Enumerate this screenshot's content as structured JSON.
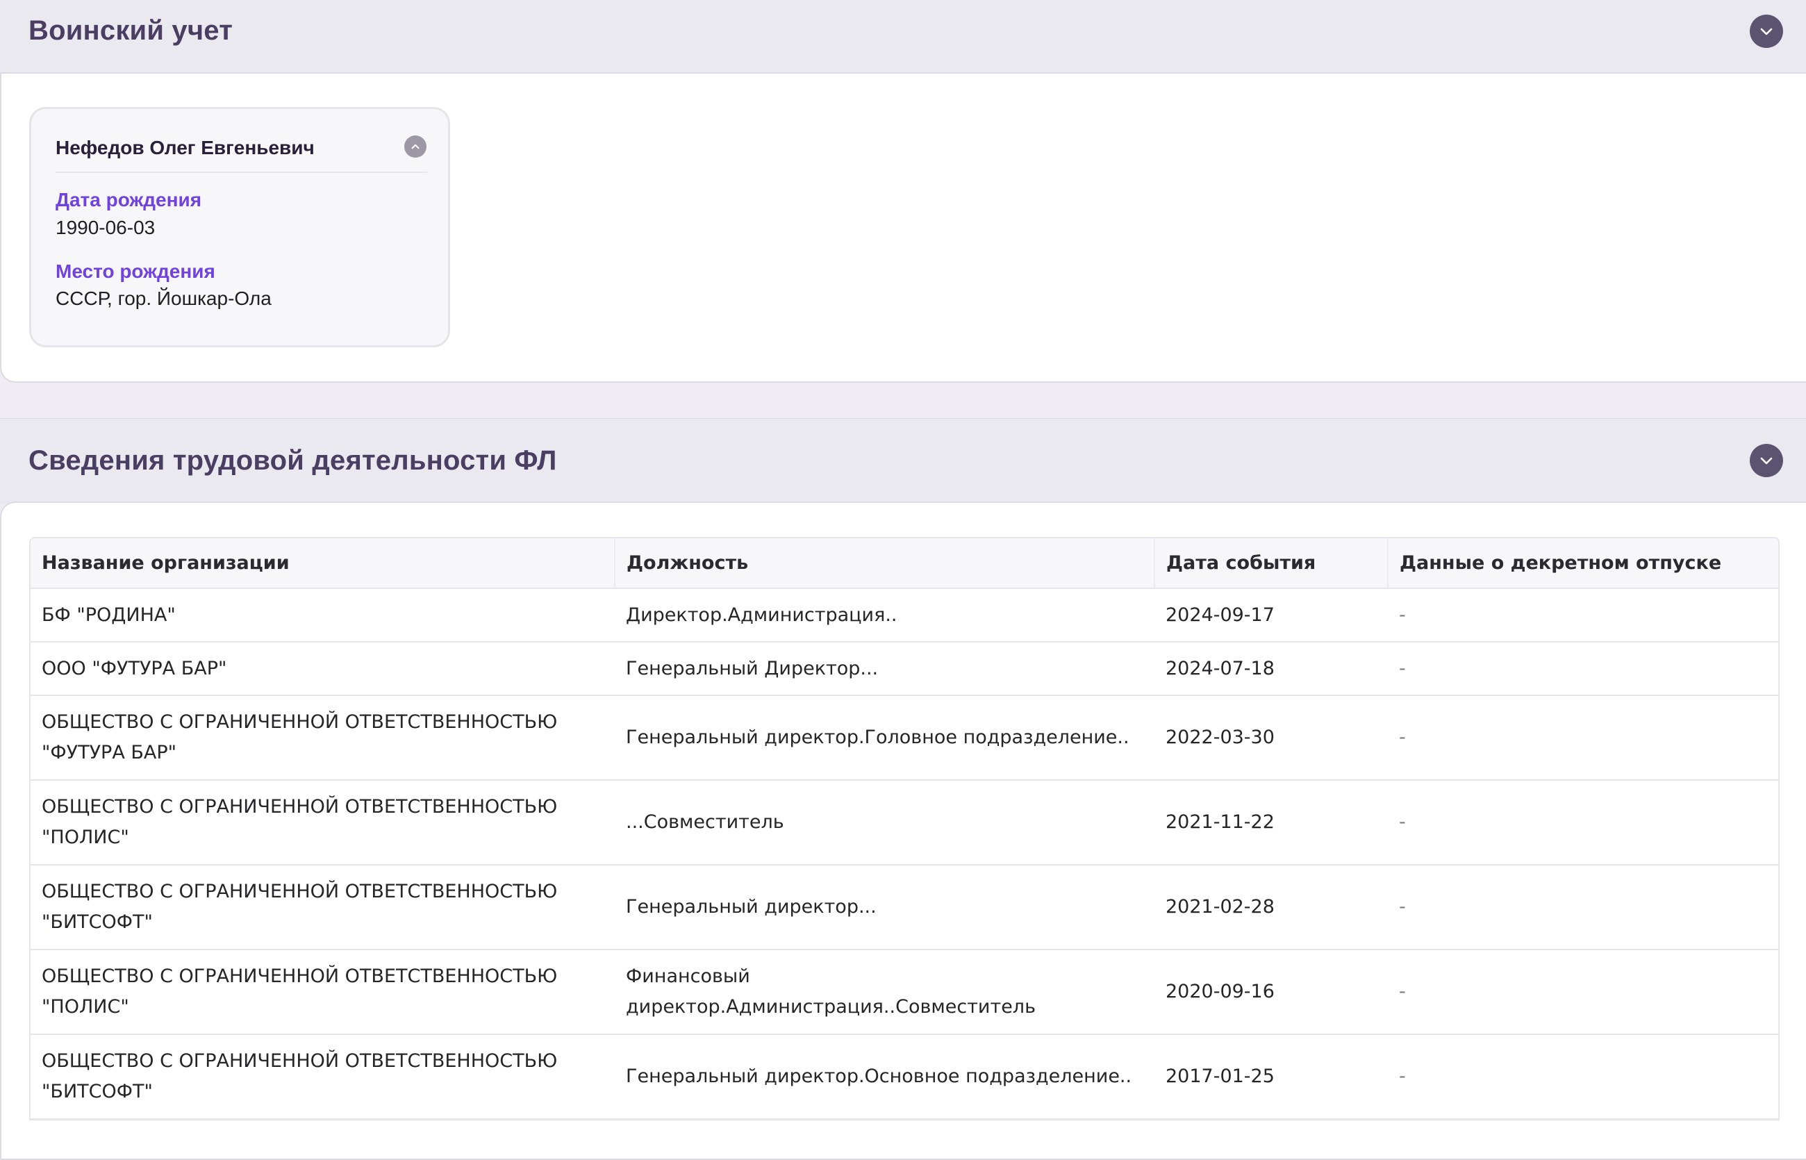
{
  "military": {
    "title": "Воинский учет",
    "person": {
      "name": "Нефедов Олег Евгеньевич",
      "birth_date_label": "Дата рождения",
      "birth_date": "1990-06-03",
      "birth_place_label": "Место рождения",
      "birth_place": "СССР, гор. Йошкар-Ола"
    }
  },
  "employment": {
    "title": "Сведения трудовой деятельности ФЛ",
    "columns": [
      "Название организации",
      "Должность",
      "Дата события",
      "Данные о декретном отпуске"
    ],
    "rows": [
      {
        "org": "БФ \"РОДИНА\"",
        "position": "Директор.Администрация..",
        "date": "2024-09-17",
        "maternity": "-"
      },
      {
        "org": "ООО \"ФУТУРА БАР\"",
        "position": "Генеральный Директор...",
        "date": "2024-07-18",
        "maternity": "-"
      },
      {
        "org": "ОБЩЕСТВО С ОГРАНИЧЕННОЙ ОТВЕТСТВЕННОСТЬЮ \"ФУТУРА БАР\"",
        "position": "Генеральный директор.Головное подразделение..",
        "date": "2022-03-30",
        "maternity": "-"
      },
      {
        "org": "ОБЩЕСТВО С ОГРАНИЧЕННОЙ ОТВЕТСТВЕННОСТЬЮ \"ПОЛИС\"",
        "position": "...Совместитель",
        "date": "2021-11-22",
        "maternity": "-"
      },
      {
        "org": "ОБЩЕСТВО С ОГРАНИЧЕННОЙ ОТВЕТСТВЕННОСТЬЮ \"БИТСОФТ\"",
        "position": "Генеральный директор...",
        "date": "2021-02-28",
        "maternity": "-"
      },
      {
        "org": "ОБЩЕСТВО С ОГРАНИЧЕННОЙ ОТВЕТСТВЕННОСТЬЮ \"ПОЛИС\"",
        "position": "Финансовый директор.Администрация..Совместитель",
        "date": "2020-09-16",
        "maternity": "-"
      },
      {
        "org": "ОБЩЕСТВО С ОГРАНИЧЕННОЙ ОТВЕТСТВЕННОСТЬЮ \"БИТСОФТ\"",
        "position": "Генеральный директор.Основное подразделение..",
        "date": "2017-01-25",
        "maternity": "-"
      }
    ]
  },
  "icons": {
    "section_toggle": "chevron-down-icon",
    "card_toggle": "chevron-up-icon"
  },
  "colors": {
    "header_bg": "#ebe9f0",
    "title": "#4a3f63",
    "accent_label": "#7043e0",
    "toggle_bg": "#5b5370"
  }
}
